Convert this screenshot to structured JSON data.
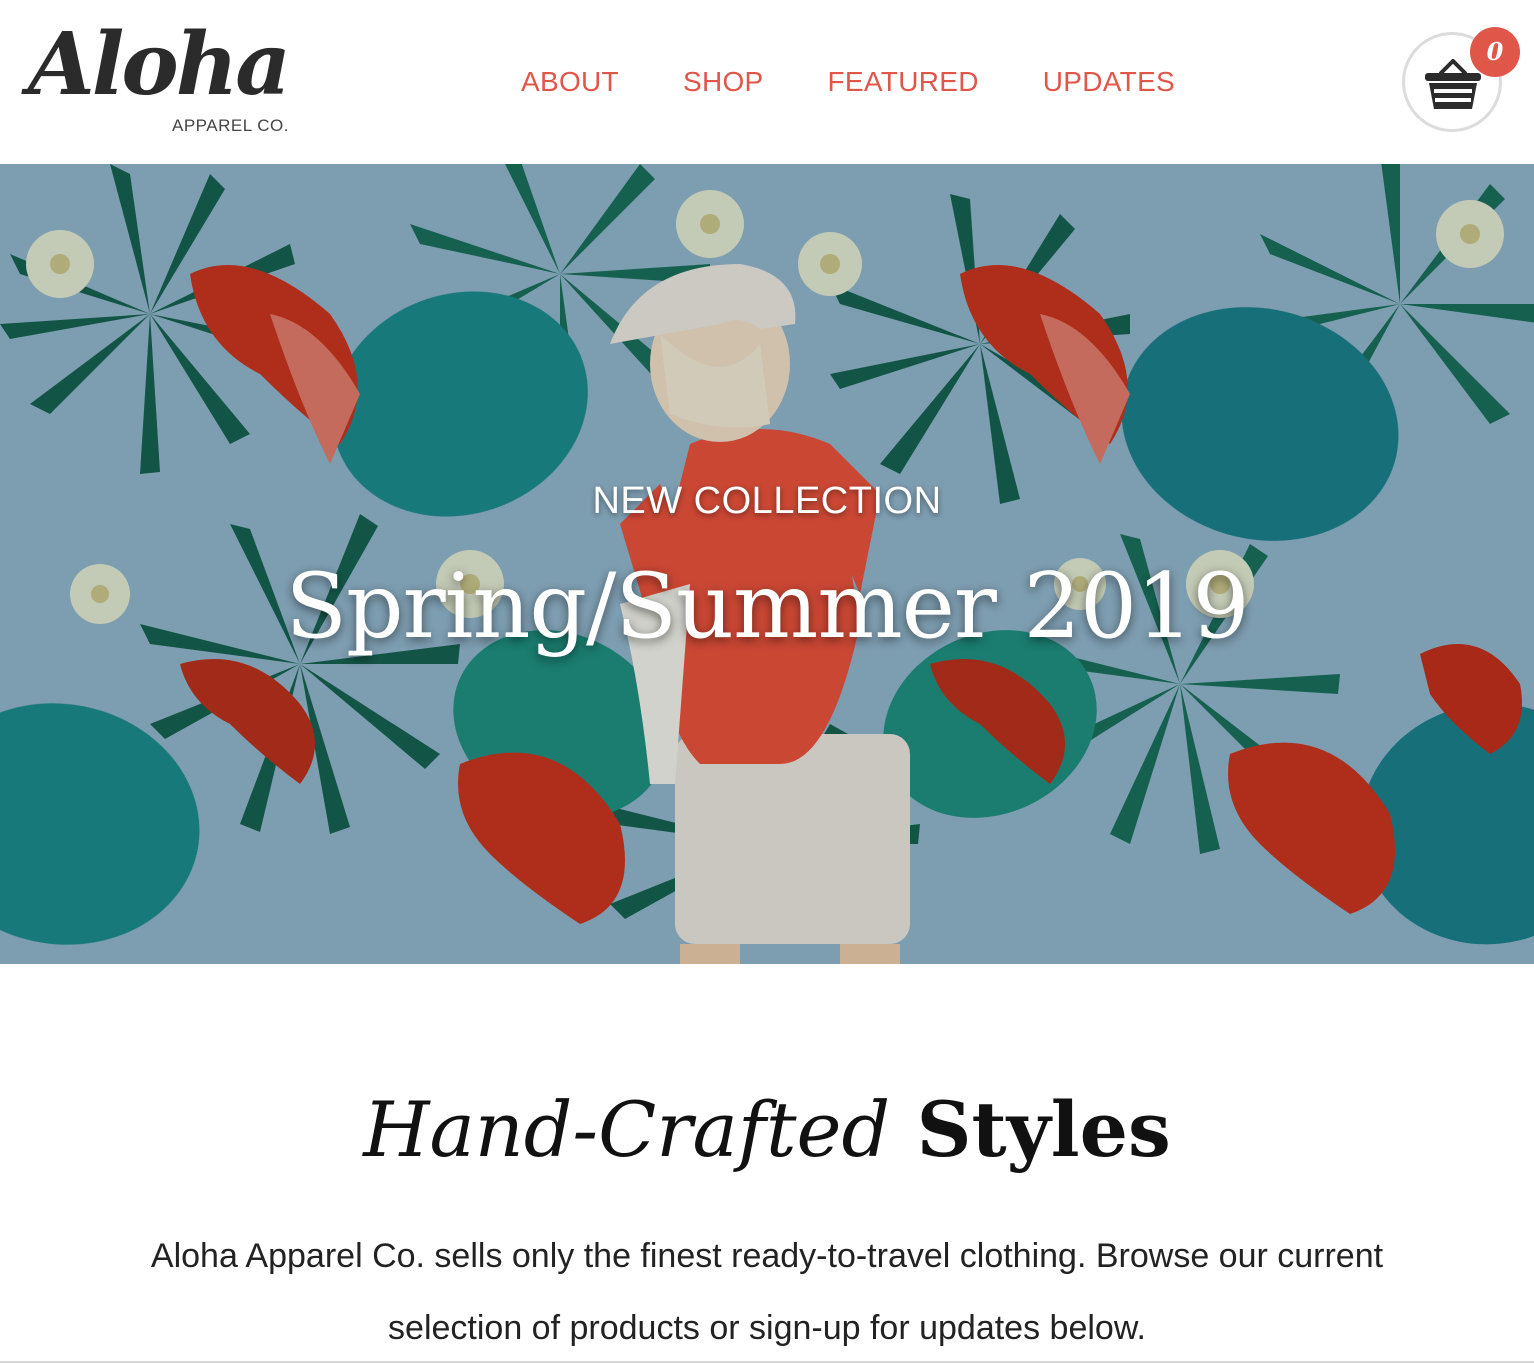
{
  "brand": {
    "script_name": "Aloha",
    "sub_name": "APPAREL CO."
  },
  "nav": {
    "items": [
      {
        "label": "ABOUT"
      },
      {
        "label": "SHOP"
      },
      {
        "label": "FEATURED"
      },
      {
        "label": "UPDATES"
      }
    ]
  },
  "cart": {
    "icon": "basket-icon",
    "count": "0"
  },
  "hero": {
    "eyebrow": "NEW COLLECTION",
    "title": "Spring/Summer 2019"
  },
  "intro": {
    "title_italic": "Hand-Crafted",
    "title_bold": "Styles",
    "body": "Aloha Apparel Co. sells only the finest ready-to-travel clothing. Browse our current selection of products or sign-up for updates below."
  },
  "colors": {
    "accent": "#e0574a",
    "hero_sky": "#8fb3c9",
    "leaf_dark": "#0f5d4a",
    "leaf_teal": "#1b8a8a",
    "flower_red": "#c8351f",
    "flower_cream": "#dfe6cf"
  }
}
